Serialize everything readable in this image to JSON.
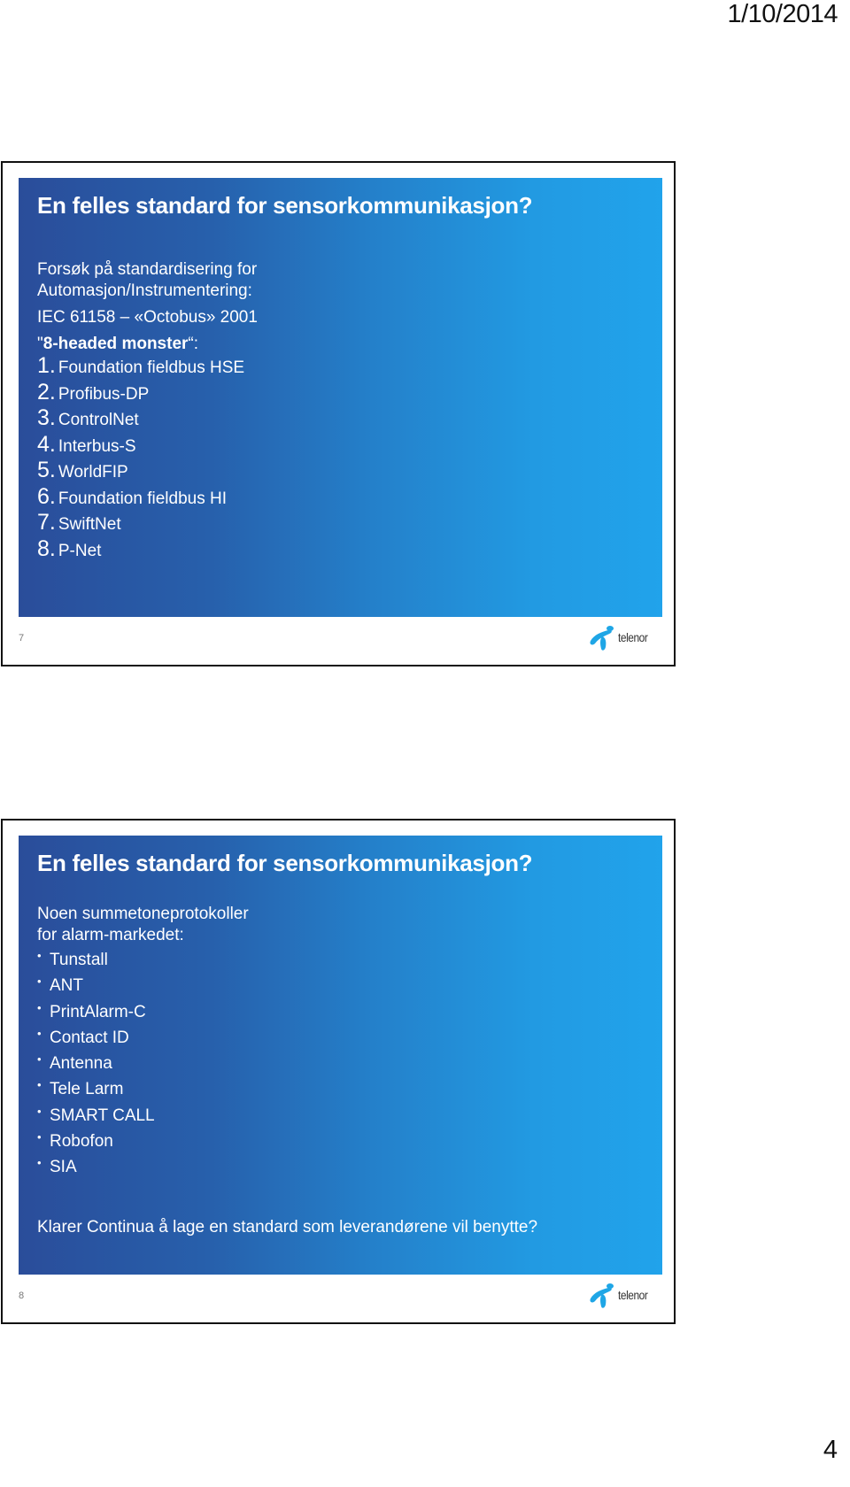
{
  "page": {
    "date": "1/10/2014",
    "number": "4"
  },
  "slides": [
    {
      "number": "7",
      "title": "En felles standard for sensorkommunikasjon?",
      "intro_lines": [
        "Forsøk på standardisering for",
        "Automasjon/Instrumentering:"
      ],
      "standard_line": "IEC 61158 – «Octobus»  2001",
      "monster_line": {
        "open_quote": "\"",
        "bold": "8-headed monster",
        "close": "“:"
      },
      "numbered_items": [
        {
          "num": "1.",
          "text": "Foundation fieldbus HSE"
        },
        {
          "num": "2.",
          "text": "Profibus-DP"
        },
        {
          "num": "3.",
          "text": "ControlNet"
        },
        {
          "num": "4.",
          "text": "Interbus-S"
        },
        {
          "num": "5.",
          "text": "WorldFIP"
        },
        {
          "num": "6.",
          "text": "Foundation fieldbus HI"
        },
        {
          "num": "7.",
          "text": "SwiftNet"
        },
        {
          "num": "8.",
          "text": "P-Net"
        }
      ],
      "logo_text": "telenor"
    },
    {
      "number": "8",
      "title": "En felles standard for sensorkommunikasjon?",
      "intro_lines": [
        "Noen summetoneprotokoller",
        "for alarm-markedet:"
      ],
      "bullet_symbol": "•",
      "bullet_items": [
        "Tunstall",
        "ANT",
        "PrintAlarm-C",
        "Contact ID",
        "Antenna",
        "Tele Larm",
        "SMART CALL",
        "Robofon",
        "SIA"
      ],
      "closing": "Klarer Continua å lage en standard som leverandørene vil benytte?",
      "logo_text": "telenor"
    }
  ],
  "colors": {
    "gradient_start": "#2a4d9a",
    "gradient_end": "#21a3eb",
    "logo_blue": "#1fa6e6"
  }
}
